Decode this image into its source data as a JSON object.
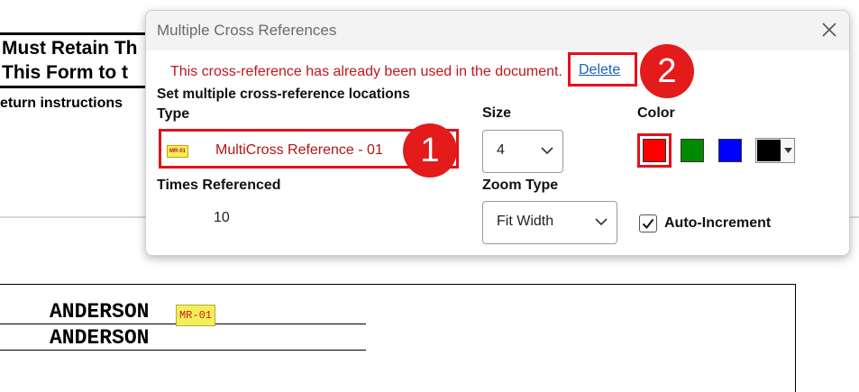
{
  "document": {
    "heading_line1": "Must Retain Th",
    "heading_line2": "This Form to t",
    "instructions": "eturn instructions",
    "name1": "ANDERSON",
    "name2": "ANDERSON",
    "inline_tag": "MR-01"
  },
  "dialog": {
    "title": "Multiple Cross References",
    "close_icon": "close-icon",
    "warning": "This cross-reference has already been used in the document.",
    "delete_label": "Delete",
    "section_label": "Set multiple cross-reference locations",
    "type": {
      "label": "Type",
      "tag": "MR-01",
      "value": "MultiCross Reference - 01"
    },
    "size": {
      "label": "Size",
      "value": "4"
    },
    "color": {
      "label": "Color",
      "swatches": [
        "#ff0000",
        "#008a00",
        "#0000ff",
        "#000000"
      ],
      "selected": "#ff0000"
    },
    "times_referenced": {
      "label": "Times Referenced",
      "value": "10"
    },
    "zoom_type": {
      "label": "Zoom Type",
      "value": "Fit Width"
    },
    "auto_increment": {
      "label": "Auto-Increment",
      "checked": true
    }
  },
  "annotations": {
    "badge1": "1",
    "badge2": "2",
    "accent_color": "#e31b1b"
  }
}
